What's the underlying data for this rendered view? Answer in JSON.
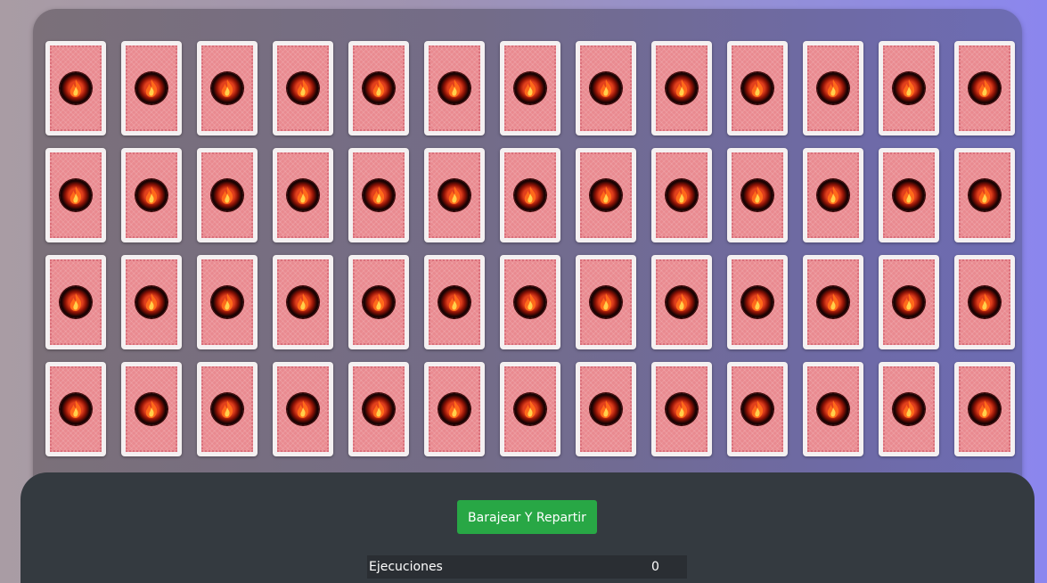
{
  "board": {
    "rows": 4,
    "columns": 13,
    "card_state": "face-down",
    "card_back_color": "#e98a90",
    "emblem_color": "#e2401c"
  },
  "controls": {
    "shuffle_deal_label": "Barajear Y Repartir",
    "button_color": "#28a745"
  },
  "stats": {
    "executions_label": "Ejecuciones",
    "executions_value": "0"
  }
}
